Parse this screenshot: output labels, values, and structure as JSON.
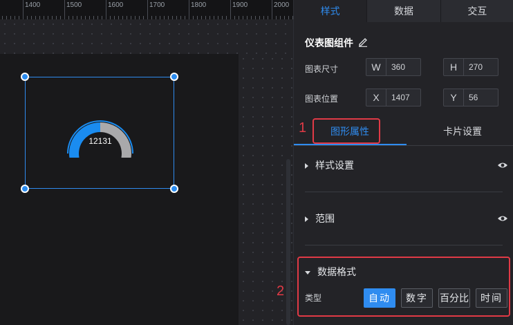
{
  "ruler": {
    "labels": [
      "1400",
      "1500",
      "1600",
      "1700",
      "1800",
      "1900",
      "2000"
    ]
  },
  "gauge": {
    "value": "12131",
    "fill_fraction": 0.5,
    "colors": {
      "fill": "#1a8cf0",
      "track": "#a9a9ab"
    }
  },
  "panel": {
    "tabs": [
      {
        "label": "样式"
      },
      {
        "label": "数据"
      },
      {
        "label": "交互"
      }
    ],
    "component_title": "仪表图组件",
    "size": {
      "label": "图表尺寸",
      "w_prefix": "W",
      "w": "360",
      "h_prefix": "H",
      "h": "270"
    },
    "position": {
      "label": "图表位置",
      "x_prefix": "X",
      "x": "1407",
      "y_prefix": "Y",
      "y": "56"
    },
    "sub_tabs": [
      {
        "label": "图形属性"
      },
      {
        "label": "卡片设置"
      }
    ],
    "sections": {
      "style": "样式设置",
      "range": "范围",
      "data_format": "数据格式"
    },
    "data_format": {
      "type_label": "类型",
      "options": [
        "自动",
        "数字",
        "百分比",
        "时间"
      ],
      "selected": "自动"
    }
  },
  "annotations": {
    "mark1": "1",
    "mark2": "2"
  },
  "colors": {
    "accent": "#2f8cf0",
    "highlight": "#e13a46"
  }
}
